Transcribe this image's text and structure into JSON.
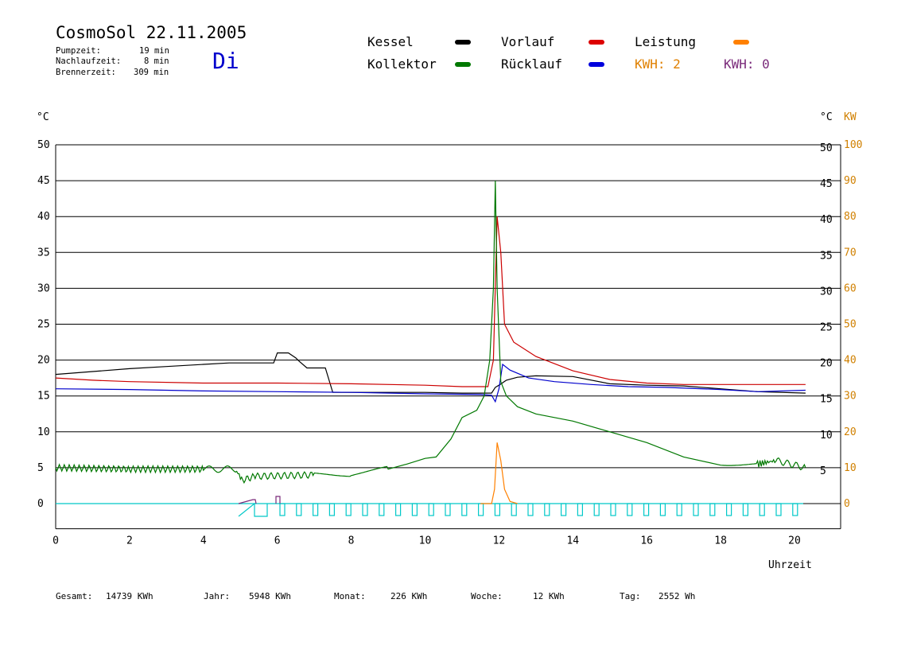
{
  "header": {
    "title": "CosmoSol 22.11.2005",
    "day": "Di",
    "stats": [
      {
        "label": "Pumpzeit:",
        "value": "19 min"
      },
      {
        "label": "Nachlaufzeit:",
        "value": "8 min"
      },
      {
        "label": "Brennerzeit:",
        "value": "309 min"
      }
    ]
  },
  "legend": {
    "kessel": "Kessel",
    "kollektor": "Kollektor",
    "vorlauf": "Vorlauf",
    "ruecklauf": "Rücklauf",
    "leistung": "Leistung",
    "kwh_orange": "KWH: 2",
    "kwh_purple": "KWH: 0"
  },
  "footer": {
    "gesamt_label": "Gesamt:",
    "gesamt_value": "14739 KWh",
    "jahr_label": "Jahr:",
    "jahr_value": "5948 KWh",
    "monat_label": "Monat:",
    "monat_value": "226 KWh",
    "woche_label": "Woche:",
    "woche_value": "12 KWh",
    "tag_label": "Tag:",
    "tag_value": "2552 Wh"
  },
  "colors": {
    "kessel": "#000000",
    "kollektor": "#007800",
    "vorlauf": "#cc0000",
    "ruecklauf": "#0000cc",
    "leistung": "#ff8000",
    "kwh_purple": "#7a2a7a",
    "pump": "#00c8c8",
    "right_axis_kw": "#d08000"
  },
  "chart_data": {
    "type": "line",
    "xlabel": "Uhrzeit",
    "ylabel_left": "°C",
    "ylabel_right_c": "°C",
    "ylabel_right_kw": "KW",
    "xlim": [
      0,
      21.2
    ],
    "ylim": [
      -3.5,
      50
    ],
    "xticks": [
      0,
      2,
      4,
      6,
      8,
      10,
      12,
      14,
      16,
      18,
      20
    ],
    "yticks": [
      0,
      5,
      10,
      15,
      20,
      25,
      30,
      35,
      40,
      45,
      50
    ],
    "yticks_kw": [
      0,
      10,
      20,
      30,
      40,
      50,
      60,
      70,
      80,
      90,
      100
    ],
    "grid": true,
    "series": [
      {
        "name": "Kessel",
        "color": "#000000",
        "x": [
          0,
          1,
          2,
          3,
          4,
          4.7,
          5.9,
          6.0,
          6.3,
          6.5,
          6.6,
          6.8,
          7.3,
          7.5,
          8.5,
          10,
          11,
          11.8,
          11.9,
          12.0,
          12.2,
          12.5,
          13,
          14,
          15,
          16,
          17,
          18,
          19,
          20.3
        ],
        "y": [
          18,
          18.4,
          18.8,
          19.1,
          19.4,
          19.6,
          19.6,
          21,
          21,
          20.3,
          19.8,
          18.9,
          18.9,
          15.5,
          15.5,
          15.5,
          15.4,
          15.4,
          16.2,
          16.5,
          17.2,
          17.6,
          17.8,
          17.7,
          16.7,
          16.5,
          16.4,
          16,
          15.6,
          15.4
        ]
      },
      {
        "name": "Vorlauf",
        "color": "#cc0000",
        "x": [
          0,
          1,
          2,
          4,
          6,
          8,
          10,
          11,
          11.7,
          11.85,
          11.95,
          12.05,
          12.15,
          12.4,
          13,
          14,
          15,
          16,
          17,
          18,
          19,
          20.3
        ],
        "y": [
          17.5,
          17.2,
          17,
          16.8,
          16.8,
          16.7,
          16.5,
          16.3,
          16.3,
          20,
          40,
          35,
          25,
          22.5,
          20.5,
          18.5,
          17.3,
          16.8,
          16.6,
          16.6,
          16.6,
          16.6
        ]
      },
      {
        "name": "Rücklauf",
        "color": "#0000cc",
        "x": [
          0,
          2,
          4,
          6,
          8,
          10,
          11.5,
          11.8,
          11.9,
          12.0,
          12.1,
          12.3,
          12.8,
          13.5,
          14.5,
          15.5,
          16.5,
          18,
          19,
          20.3
        ],
        "y": [
          16,
          15.9,
          15.7,
          15.6,
          15.5,
          15.3,
          15.2,
          15.1,
          14.2,
          16,
          19.4,
          18.6,
          17.5,
          17,
          16.6,
          16.3,
          16.2,
          15.9,
          15.6,
          15.8
        ]
      },
      {
        "name": "Kollektor",
        "color": "#007800",
        "x": [
          0,
          2,
          4,
          4.9,
          5.0,
          5.4,
          7,
          8,
          9,
          9.5,
          10,
          10.3,
          10.7,
          11,
          11.4,
          11.6,
          11.75,
          11.85,
          11.9,
          11.95,
          12.05,
          12.2,
          12.5,
          13,
          14,
          15,
          16,
          17,
          18,
          19,
          19.5,
          20.3
        ],
        "y": [
          5,
          4.8,
          4.8,
          4.8,
          3.2,
          3.8,
          4,
          4.2,
          4.8,
          5.5,
          6.3,
          6.5,
          9,
          12,
          13,
          15,
          20,
          30,
          45,
          30,
          17,
          15,
          13.5,
          12.5,
          11.5,
          10,
          8.5,
          6.5,
          5.8,
          5.5,
          6,
          5
        ]
      },
      {
        "name": "Leistung",
        "color": "#ff8000",
        "x": [
          11.5,
          11.8,
          11.88,
          11.95,
          12.05,
          12.15,
          12.3,
          12.5
        ],
        "y": [
          0,
          0,
          2,
          8.5,
          6,
          2,
          0.3,
          0
        ]
      }
    ]
  }
}
